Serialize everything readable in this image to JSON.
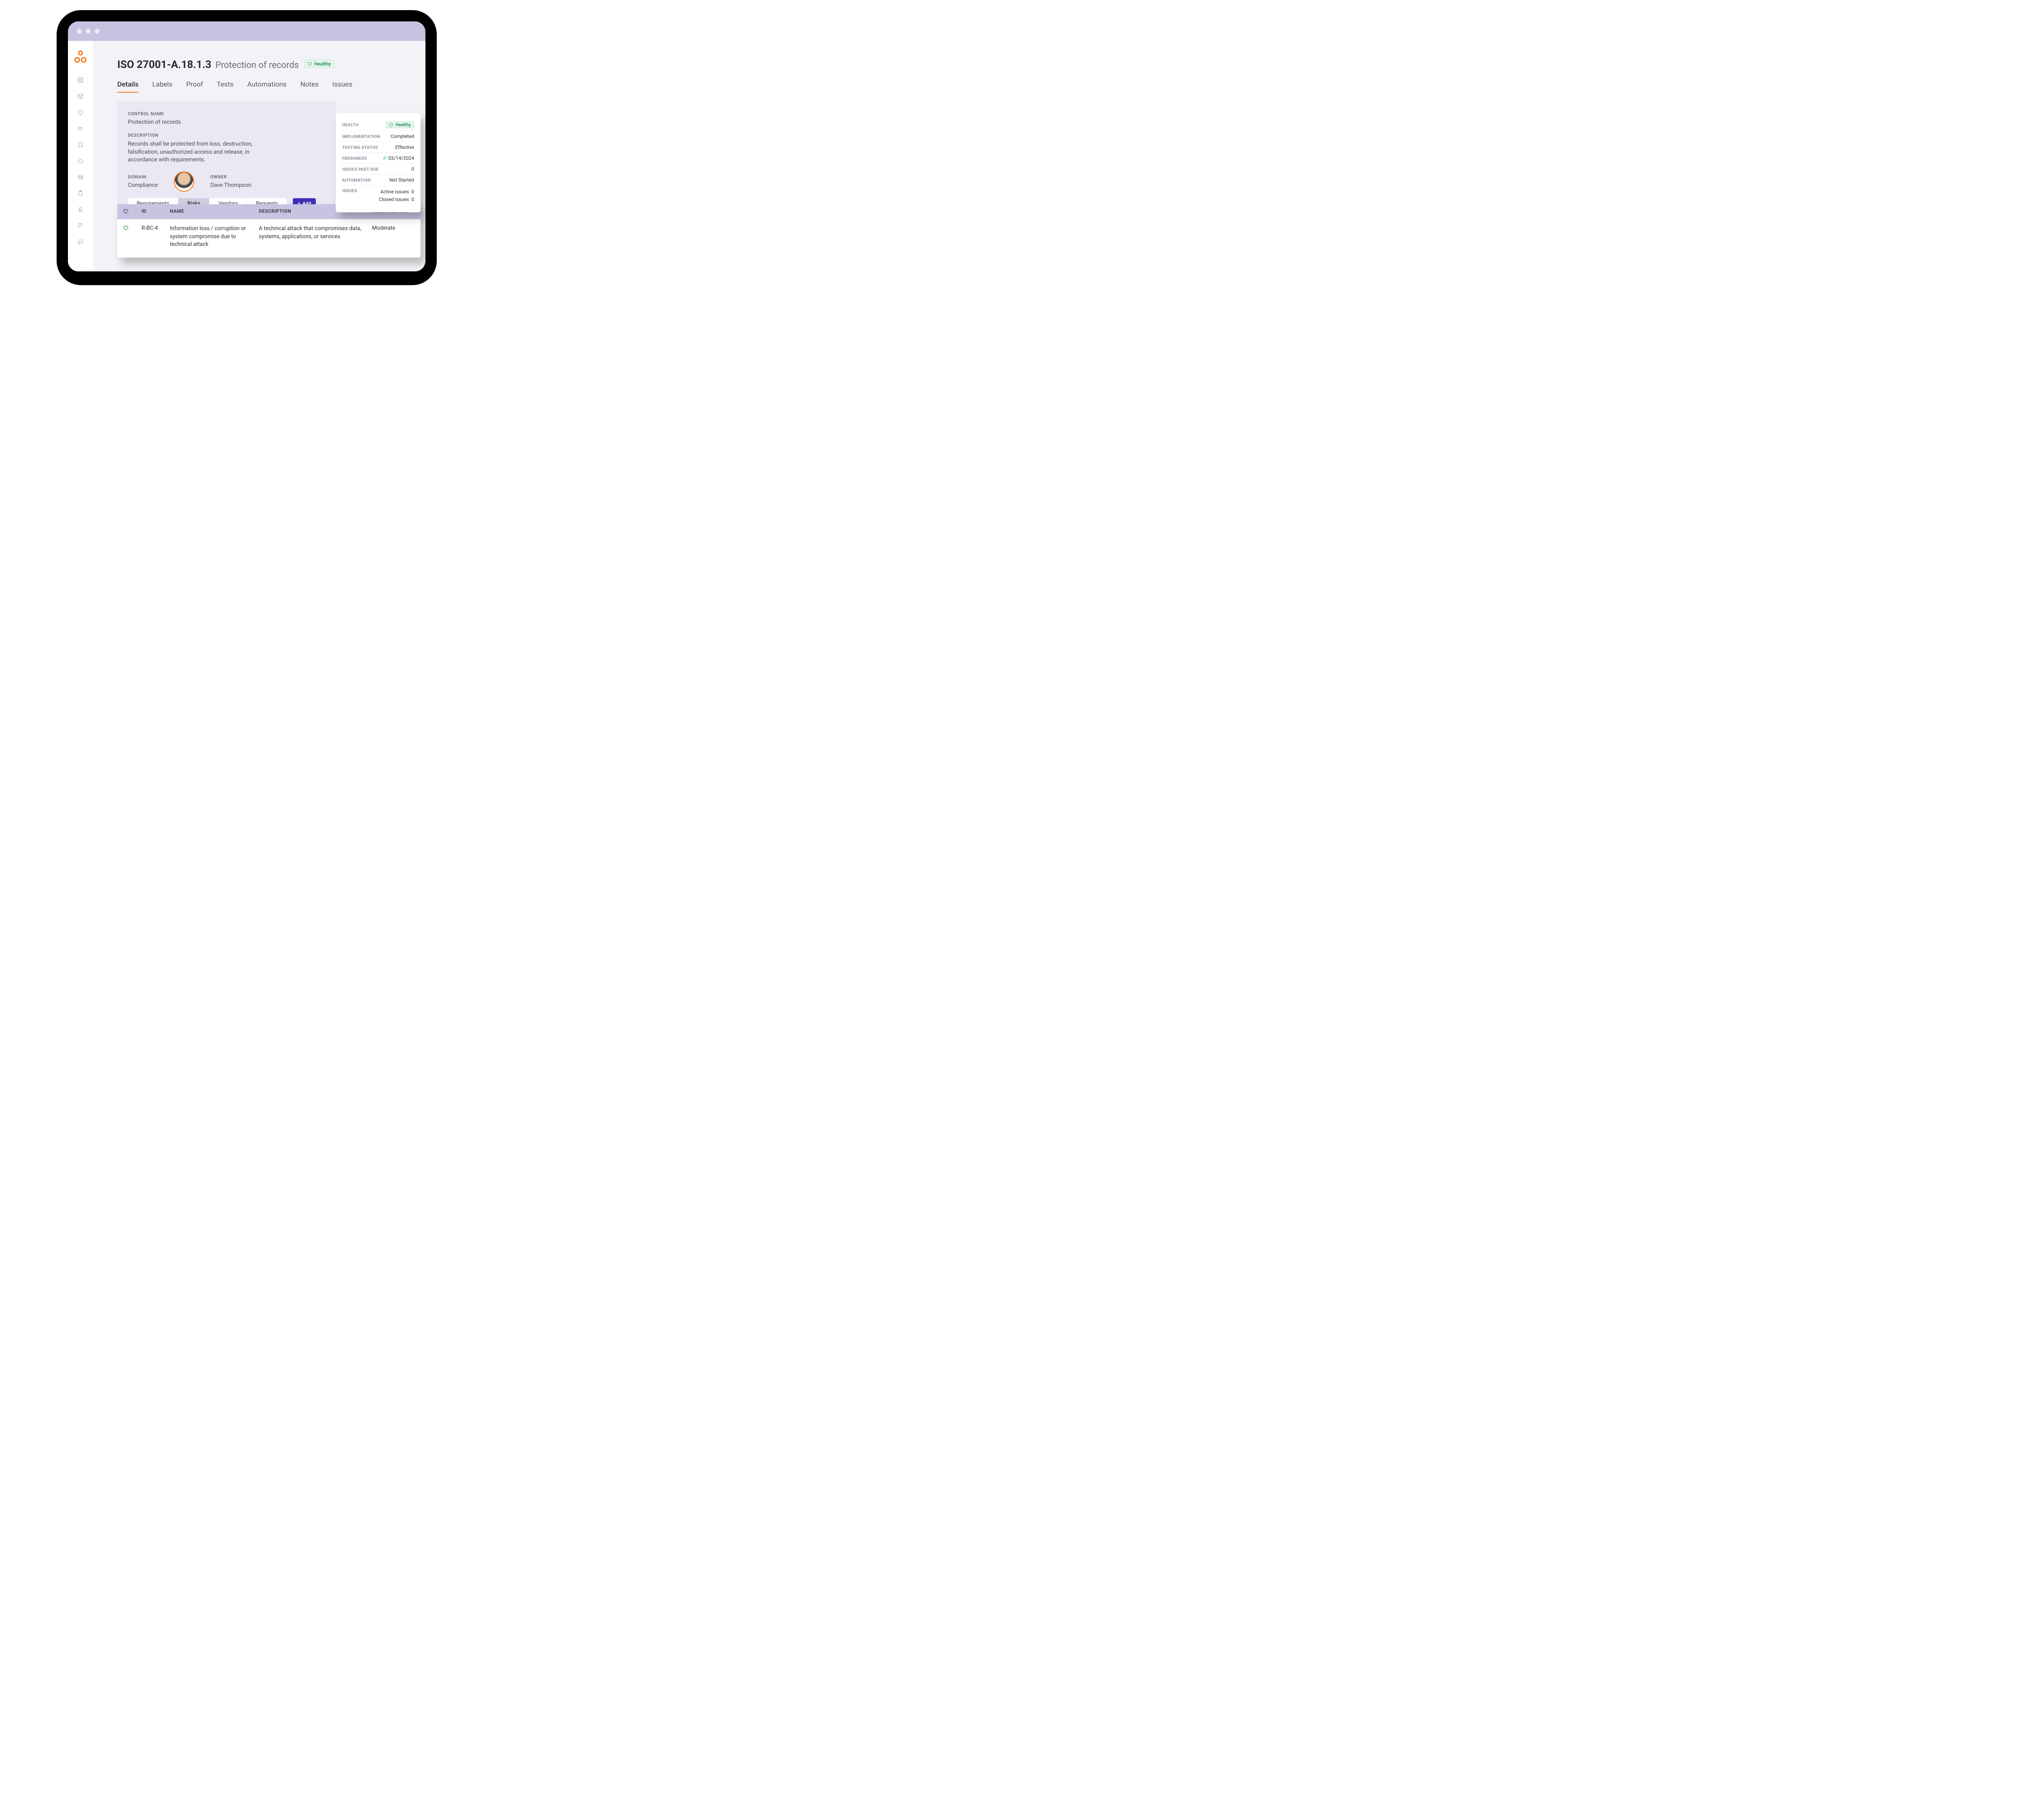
{
  "header": {
    "code": "ISO 27001-A.18.1.3",
    "title": "Protection of records",
    "health_badge": "Healthy"
  },
  "tabs": [
    "Details",
    "Labels",
    "Proof",
    "Tests",
    "Automations",
    "Notes",
    "Issues"
  ],
  "tabs_active": 0,
  "details": {
    "control_name_label": "CONTROL NAME",
    "control_name": "Protection of records",
    "description_label": "DESCRIPTION",
    "description": "Records shall be protected from loss, destruction, falsification, unauthorized access and release, in accordance with requirements.",
    "domain_label": "DOMAIN",
    "domain": "Compliance",
    "owner_label": "OWNER",
    "owner": "Dave Thompson"
  },
  "subtabs": [
    "Requirements",
    "Risks",
    "Vendors",
    "Requests"
  ],
  "subtabs_active": 1,
  "add_label": "Add",
  "status": {
    "health_k": "HEALTH",
    "health_v": "Healthy",
    "implementation_k": "IMPLEMENTATION",
    "implementation_v": "Completed",
    "testing_k": "TESTING STATUS",
    "testing_v": "Effective",
    "freshness_k": "FRESHNESS",
    "freshness_v": "03/14/2024",
    "past_due_k": "ISSUES PAST DUE",
    "past_due_v": "0",
    "automation_k": "AUTOMATION",
    "automation_v": "Not Started",
    "issues_k": "ISSUES",
    "issues_active_k": "Active issues",
    "issues_active_v": "0",
    "issues_closed_k": "Closed issues",
    "issues_closed_v": "0"
  },
  "table": {
    "head": {
      "id": "ID",
      "name": "NAME",
      "desc": "DESCRIPTION",
      "risk": "RESIDUAL RISK"
    },
    "row": {
      "id": "R-BC-4",
      "name": "Information loss / corruption or system compromise due to technical attack",
      "desc": "A technical attack that compromises data, systems, applications, or services",
      "risk": "Moderate"
    }
  }
}
